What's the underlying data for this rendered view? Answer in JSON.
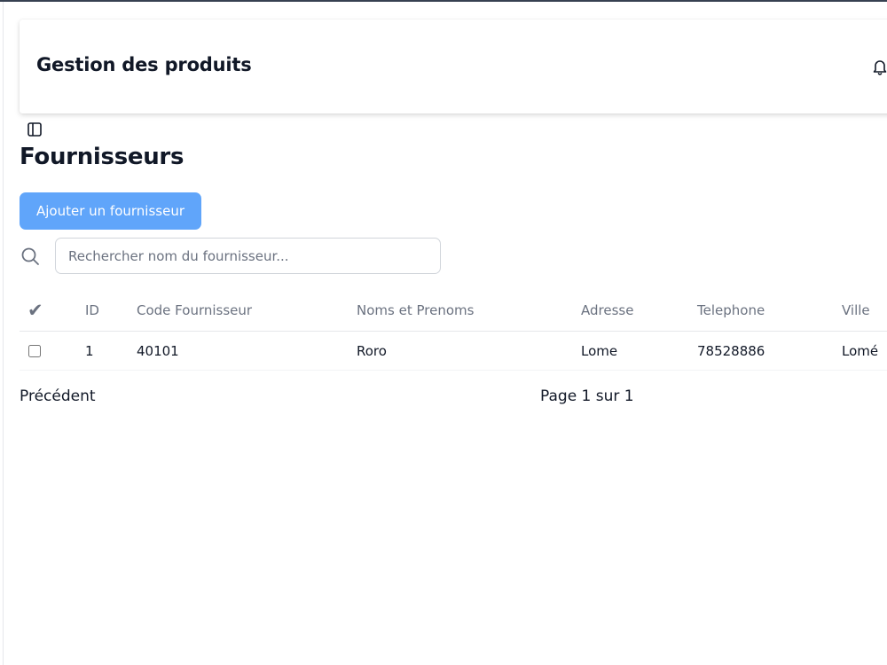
{
  "header": {
    "title": "Gestion des produits",
    "icons": [
      "bell-icon"
    ]
  },
  "sidebar_toggle_icon": "sidebar-panel-icon",
  "page": {
    "title": "Fournisseurs",
    "add_button_label": "Ajouter un fournisseur"
  },
  "search": {
    "icon": "search-icon",
    "placeholder": "Rechercher nom du fournisseur...",
    "value": ""
  },
  "table": {
    "check_header": "✔",
    "columns": [
      "ID",
      "Code Fournisseur",
      "Noms et Prenoms",
      "Adresse",
      "Telephone",
      "Ville"
    ],
    "rows": [
      {
        "checked": false,
        "cells": [
          "1",
          "40101",
          "Roro",
          "Lome",
          "78528886",
          "Lomé"
        ]
      }
    ]
  },
  "pagination": {
    "previous_label": "Précédent",
    "page_label": "Page 1 sur 1",
    "current_page": 1,
    "total_pages": 1
  },
  "colors": {
    "accent": "#60a5fa",
    "text": "#111827",
    "muted_text": "#6b7280",
    "border": "#d1d5db"
  }
}
